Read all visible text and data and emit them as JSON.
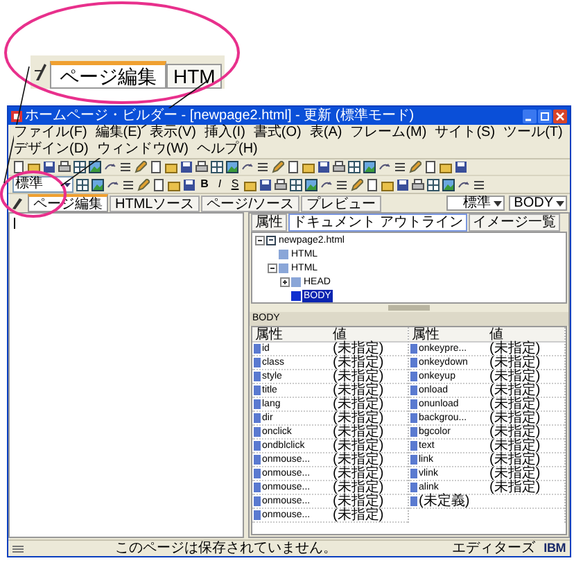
{
  "callout": {
    "tabs": [
      {
        "label": "ページ編集",
        "selected": true
      },
      {
        "label": "HTM",
        "selected": false
      }
    ]
  },
  "window": {
    "title": "ホームページ・ビルダー - [newpage2.html] - 更新 (標準モード)"
  },
  "menu": [
    "ファイル(F)",
    "編集(E)",
    "表示(V)",
    "挿入(I)",
    "書式(O)",
    "表(A)",
    "フレーム(M)",
    "サイト(S)",
    "ツール(T)",
    "デザイン(D)",
    "ウィンドウ(W)",
    "ヘルプ(H)"
  ],
  "toolbar": {
    "style_select": "標準",
    "format_buttons": [
      "B",
      "I",
      "S"
    ]
  },
  "editor_tabs": [
    {
      "label": "ページ編集",
      "selected": true
    },
    {
      "label": "HTMLソース",
      "selected": false
    },
    {
      "label": "ページ/ソース",
      "selected": false
    },
    {
      "label": "プレビュー",
      "selected": false
    }
  ],
  "editor_selects": [
    "標準",
    "BODY"
  ],
  "side_panel": {
    "tabs": [
      {
        "label": "属性",
        "selected": false
      },
      {
        "label": "ドキュメント アウトライン",
        "selected": true
      },
      {
        "label": "イメージ一覧",
        "selected": false
      }
    ],
    "outline": [
      {
        "label": "newpage2.html",
        "expanded": true,
        "selected": false,
        "children": [
          {
            "label": "HTML",
            "selected": false
          },
          {
            "label": "HTML",
            "expanded": true,
            "selected": false,
            "children": [
              {
                "label": "HEAD",
                "expanded": false,
                "selected": false
              },
              {
                "label": "BODY",
                "selected": true
              }
            ]
          }
        ]
      }
    ],
    "element_label": "BODY",
    "column_groups": [
      [
        "属性",
        "値"
      ],
      [
        "属性",
        "値"
      ]
    ],
    "properties": [
      {
        "name": "id",
        "value": "(未指定)"
      },
      {
        "name": "class",
        "value": "(未指定)"
      },
      {
        "name": "style",
        "value": "(未指定)"
      },
      {
        "name": "title",
        "value": "(未指定)"
      },
      {
        "name": "lang",
        "value": "(未指定)"
      },
      {
        "name": "dir",
        "value": "(未指定)"
      },
      {
        "name": "onclick",
        "value": "(未指定)"
      },
      {
        "name": "ondblclick",
        "value": "(未指定)"
      },
      {
        "name": "onmouse...",
        "value": "(未指定)"
      },
      {
        "name": "onmouse...",
        "value": "(未指定)"
      },
      {
        "name": "onmouse...",
        "value": "(未指定)"
      },
      {
        "name": "onmouse...",
        "value": "(未指定)"
      },
      {
        "name": "onmouse...",
        "value": "(未指定)"
      },
      {
        "name": "onkeypre...",
        "value": "(未指定)"
      },
      {
        "name": "onkeydown",
        "value": "(未指定)"
      },
      {
        "name": "onkeyup",
        "value": "(未指定)"
      },
      {
        "name": "onload",
        "value": "(未指定)"
      },
      {
        "name": "onunload",
        "value": "(未指定)"
      },
      {
        "name": "backgrou...",
        "value": "(未指定)"
      },
      {
        "name": "bgcolor",
        "value": "(未指定)"
      },
      {
        "name": "text",
        "value": "(未指定)"
      },
      {
        "name": "link",
        "value": "(未指定)"
      },
      {
        "name": "vlink",
        "value": "(未指定)"
      },
      {
        "name": "alink",
        "value": "(未指定)"
      },
      {
        "name": "(未定義)"
      }
    ]
  },
  "status_bar": {
    "message": "このページは保存されていません。",
    "mode": "エディターズ",
    "logo": "IBM"
  }
}
